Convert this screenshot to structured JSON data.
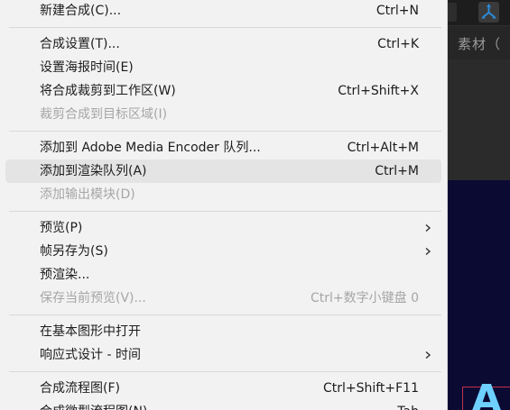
{
  "background_app": {
    "panel_tab_label": "素材（",
    "comp_letter": "A"
  },
  "menu": {
    "groups": [
      [
        {
          "label": "新建合成(C)...",
          "shortcut": "Ctrl+N",
          "disabled": false,
          "submenu": false
        }
      ],
      [
        {
          "label": "合成设置(T)...",
          "shortcut": "Ctrl+K",
          "disabled": false,
          "submenu": false
        },
        {
          "label": "设置海报时间(E)",
          "shortcut": "",
          "disabled": false,
          "submenu": false
        },
        {
          "label": "将合成裁剪到工作区(W)",
          "shortcut": "Ctrl+Shift+X",
          "disabled": false,
          "submenu": false
        },
        {
          "label": "裁剪合成到目标区域(I)",
          "shortcut": "",
          "disabled": true,
          "submenu": false
        }
      ],
      [
        {
          "label": "添加到 Adobe Media Encoder 队列...",
          "shortcut": "Ctrl+Alt+M",
          "disabled": false,
          "submenu": false
        },
        {
          "label": "添加到渲染队列(A)",
          "shortcut": "Ctrl+M",
          "disabled": false,
          "submenu": false,
          "hovered": true
        },
        {
          "label": "添加输出模块(D)",
          "shortcut": "",
          "disabled": true,
          "submenu": false
        }
      ],
      [
        {
          "label": "预览(P)",
          "shortcut": "",
          "disabled": false,
          "submenu": true
        },
        {
          "label": "帧另存为(S)",
          "shortcut": "",
          "disabled": false,
          "submenu": true
        },
        {
          "label": "预渲染...",
          "shortcut": "",
          "disabled": false,
          "submenu": false
        },
        {
          "label": "保存当前预览(V)...",
          "shortcut": "Ctrl+数字小键盘 0",
          "disabled": true,
          "submenu": false
        }
      ],
      [
        {
          "label": "在基本图形中打开",
          "shortcut": "",
          "disabled": false,
          "submenu": false
        },
        {
          "label": "响应式设计 - 时间",
          "shortcut": "",
          "disabled": false,
          "submenu": true
        }
      ],
      [
        {
          "label": "合成流程图(F)",
          "shortcut": "Ctrl+Shift+F11",
          "disabled": false,
          "submenu": false
        },
        {
          "label": "合成微型流程图(N)",
          "shortcut": "Tab",
          "disabled": false,
          "submenu": false
        }
      ]
    ]
  },
  "colors": {
    "menu_bg": "#f2f2f2",
    "menu_text": "#1c1c1c",
    "disabled_text": "#a6a6a6",
    "hover_bg": "#e4e4e4",
    "comp_bg": "#0a0a33",
    "accent_blue": "#2a8ad8"
  },
  "icons": {
    "toolbar_tool": "3d-axis-icon",
    "submenu": "chevron-right-icon"
  }
}
